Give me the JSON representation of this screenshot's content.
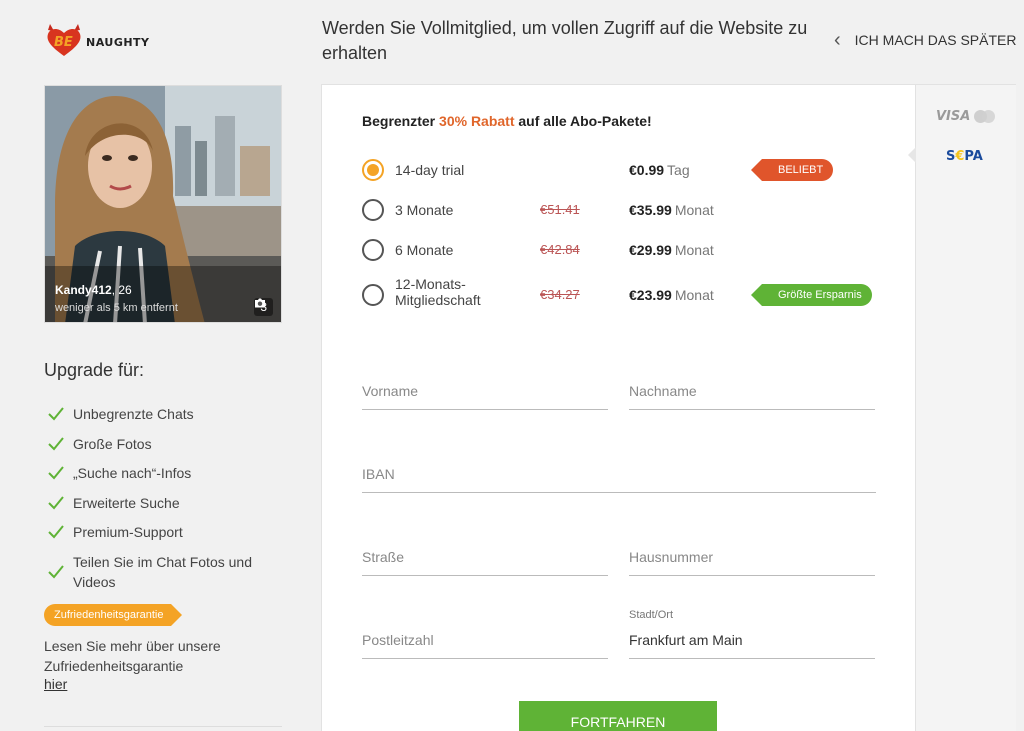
{
  "brand": {
    "logo_text": "NAUGHTY",
    "logo_badge": "BE"
  },
  "header": {
    "title": "Werden Sie Vollmitglied, um vollen Zugriff auf die Website zu erhalten",
    "later_label": "ICH MACH DAS SPÄTER"
  },
  "profile": {
    "name": "Kandy412",
    "age": ", 26",
    "distance": "weniger als 5 km entfernt",
    "photo_count": "3"
  },
  "upgrade": {
    "title": "Upgrade für:",
    "features": [
      "Unbegrenzte Chats",
      "Große Fotos",
      "„Suche nach“-Infos",
      "Erweiterte Suche",
      "Premium-Support",
      "Teilen Sie im Chat Fotos und Videos"
    ],
    "guarantee_badge": "Zufriedenheitsgarantie",
    "guarantee_text": "Lesen Sie mehr über unsere Zufriedenheitsgarantie",
    "guarantee_link": "hier"
  },
  "promo": {
    "prefix": "Begrenzter ",
    "highlight": "30% Rabatt",
    "suffix": " auf alle Abo-Pakete!"
  },
  "plans": [
    {
      "name": "14-day trial",
      "old_price": "",
      "price": "€0.99",
      "unit": "Tag",
      "tag": "BELIEBT",
      "selected": true
    },
    {
      "name": "3 Monate",
      "old_price": "€51.41",
      "price": "€35.99",
      "unit": "Monat",
      "tag": "",
      "selected": false
    },
    {
      "name": "6 Monate",
      "old_price": "€42.84",
      "price": "€29.99",
      "unit": "Monat",
      "tag": "",
      "selected": false
    },
    {
      "name": "12-Monats-Mitgliedschaft",
      "old_price": "€34.27",
      "price": "€23.99",
      "unit": "Monat",
      "tag": "Größte Ersparnis",
      "selected": false
    }
  ],
  "form": {
    "first_name_placeholder": "Vorname",
    "last_name_placeholder": "Nachname",
    "iban_placeholder": "IBAN",
    "street_placeholder": "Straße",
    "house_number_placeholder": "Hausnummer",
    "postcode_placeholder": "Postleitzahl",
    "city_label": "Stadt/Ort",
    "city_value": "Frankfurt am Main",
    "continue_label": "FORTFAHREN"
  },
  "payment": {
    "visa_label": "VISA",
    "sepa_s": "S",
    "sepa_euro": "€",
    "sepa_rest": "PA"
  },
  "colors": {
    "accent_orange": "#f4a325",
    "promo_orange": "#e0662b",
    "popular_red": "#e0552b",
    "green": "#5fb336"
  }
}
